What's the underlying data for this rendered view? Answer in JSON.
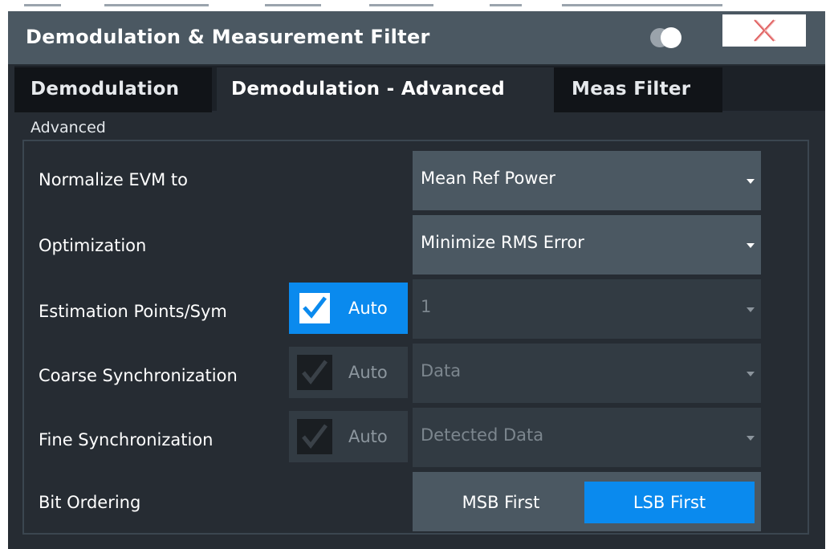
{
  "dialog": {
    "title": "Demodulation & Measurement Filter",
    "tabs": [
      {
        "label": "Demodulation",
        "active": false
      },
      {
        "label": "Demodulation - Advanced",
        "active": true
      },
      {
        "label": "Meas Filter",
        "active": false
      }
    ],
    "group_label": "Advanced"
  },
  "rows": {
    "normalize_evm": {
      "label": "Normalize EVM to",
      "value": "Mean Ref Power"
    },
    "optimization": {
      "label": "Optimization",
      "value": "Minimize RMS Error"
    },
    "estimation_points": {
      "label": "Estimation Points/Sym",
      "auto_label": "Auto",
      "auto_checked": true,
      "value": "1"
    },
    "coarse_sync": {
      "label": "Coarse Synchronization",
      "auto_label": "Auto",
      "auto_checked": true,
      "value": "Data"
    },
    "fine_sync": {
      "label": "Fine Synchronization",
      "auto_label": "Auto",
      "auto_checked": true,
      "value": "Detected Data"
    },
    "bit_ordering": {
      "label": "Bit Ordering",
      "options": [
        "MSB First",
        "LSB First"
      ],
      "selected": "LSB First"
    }
  },
  "colors": {
    "accent": "#0a8aee",
    "close_icon": "#e06060",
    "titlebar": "#4b5862",
    "background": "#262c33"
  },
  "icons": [
    "toggle-icon",
    "close-icon",
    "checkmark-icon",
    "dropdown-arrow-icon"
  ]
}
